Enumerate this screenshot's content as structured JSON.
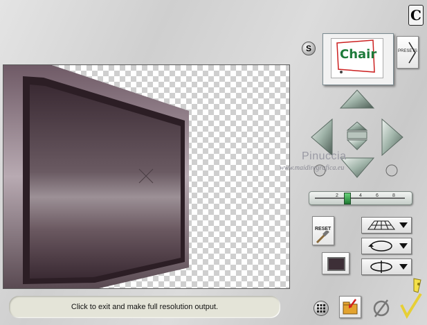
{
  "status": {
    "message": "Click to exit and make full resolution output."
  },
  "header": {
    "s_label": "S",
    "logo_letter": "C"
  },
  "presets": {
    "label": "PRESETS",
    "thumbnail_text": "Chair"
  },
  "reset": {
    "label": "RESET"
  },
  "watermark": {
    "name": "Pinuccia",
    "site": "www.maidiregrafica.eu"
  },
  "slider": {
    "ticks": [
      "2",
      "4",
      "6",
      "8"
    ],
    "value_fraction": 0.35
  },
  "colors": {
    "frame": "#584750",
    "background": "#d6d6d6",
    "status_bar": "#e4e4d8",
    "arrow": "#9fb3a8"
  },
  "icons": [
    "grid-icon",
    "folder-export-icon",
    "disable-icon",
    "apply-check-icon",
    "perspective-grid-icon",
    "rotate-icon",
    "spin-icon"
  ]
}
